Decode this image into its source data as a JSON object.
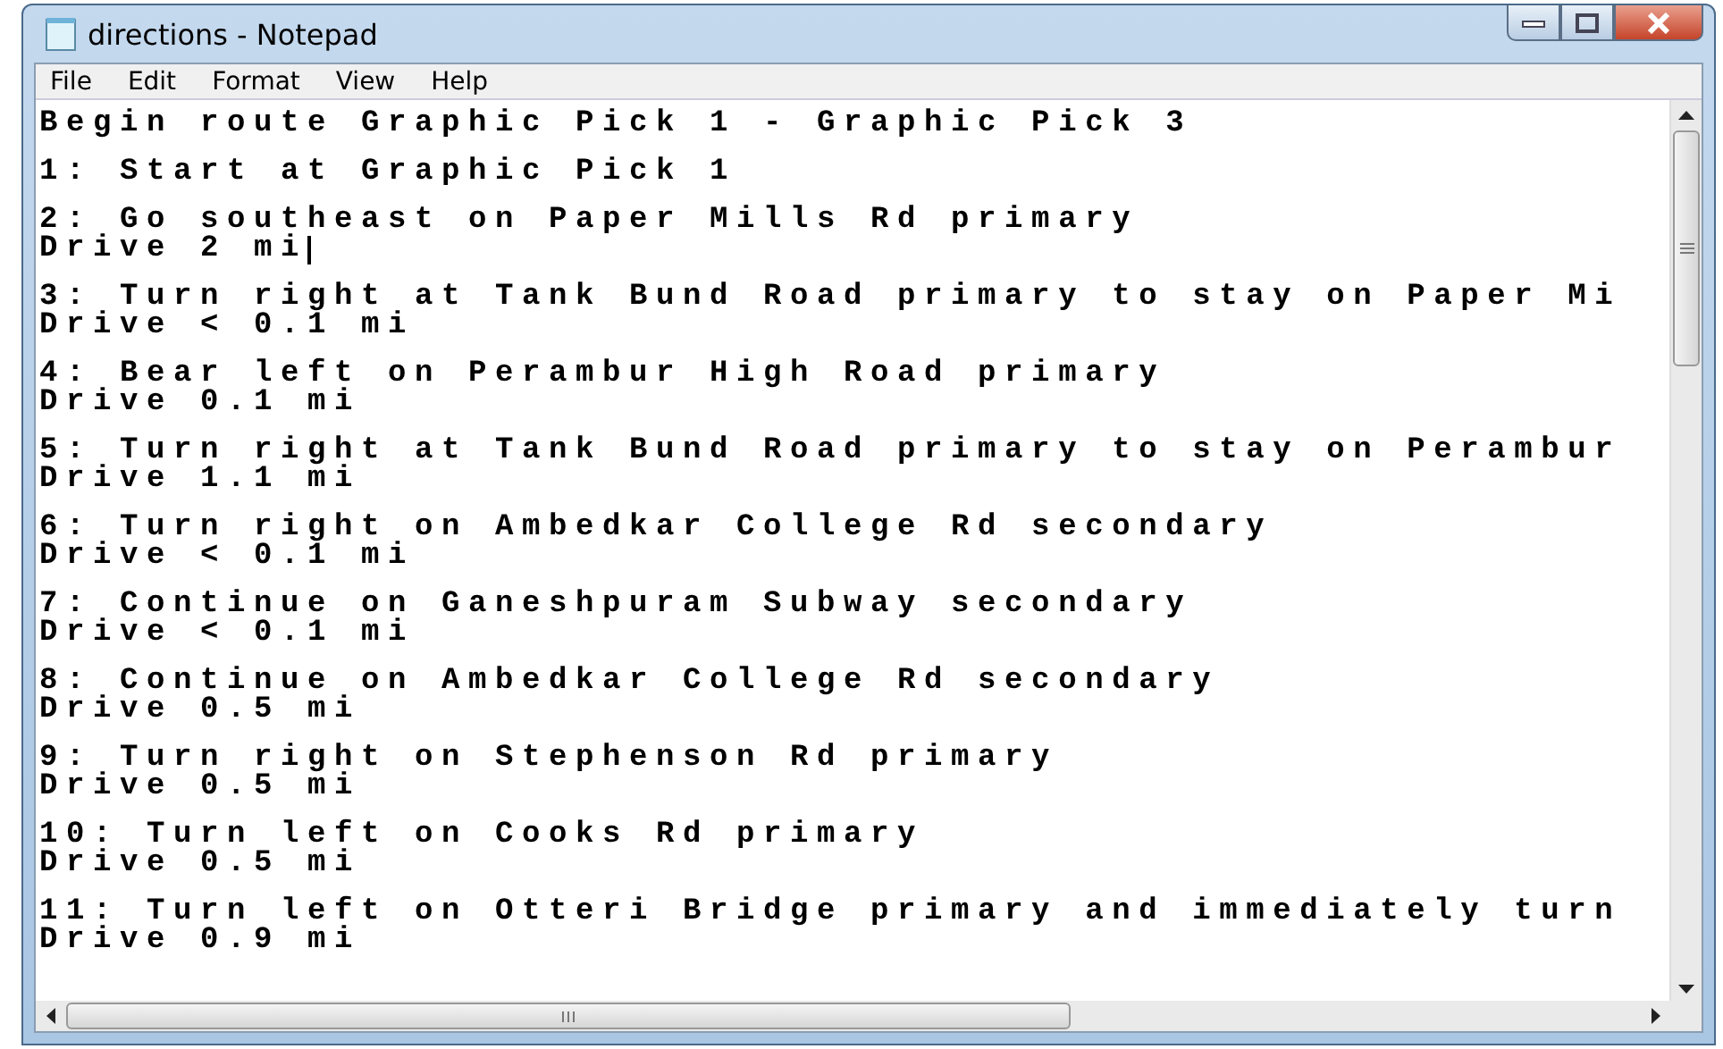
{
  "window": {
    "title": "directions - Notepad"
  },
  "menu": [
    "File",
    "Edit",
    "Format",
    "View",
    "Help"
  ],
  "document": {
    "blocks": [
      {
        "lines": [
          {
            "text": "Begin route Graphic Pick 1 - Graphic Pick 3",
            "caret": false
          }
        ]
      },
      {
        "lines": [
          {
            "text": "1: Start at Graphic Pick 1",
            "caret": false
          }
        ]
      },
      {
        "lines": [
          {
            "text": "2: Go southeast on Paper Mills Rd primary",
            "caret": false
          },
          {
            "text": "Drive 2 mi",
            "caret": true
          }
        ]
      },
      {
        "lines": [
          {
            "text": "3: Turn right at Tank Bund Road primary to stay on Paper Mi",
            "caret": false
          },
          {
            "text": "Drive < 0.1 mi",
            "caret": false
          }
        ]
      },
      {
        "lines": [
          {
            "text": "4: Bear left on Perambur High Road primary",
            "caret": false
          },
          {
            "text": "Drive 0.1 mi",
            "caret": false
          }
        ]
      },
      {
        "lines": [
          {
            "text": "5: Turn right at Tank Bund Road primary to stay on Perambur",
            "caret": false
          },
          {
            "text": "Drive 1.1 mi",
            "caret": false
          }
        ]
      },
      {
        "lines": [
          {
            "text": "6: Turn right on Ambedkar College Rd secondary",
            "caret": false
          },
          {
            "text": "Drive < 0.1 mi",
            "caret": false
          }
        ]
      },
      {
        "lines": [
          {
            "text": "7: Continue on Ganeshpuram Subway secondary",
            "caret": false
          },
          {
            "text": "Drive < 0.1 mi",
            "caret": false
          }
        ]
      },
      {
        "lines": [
          {
            "text": "8: Continue on Ambedkar College Rd secondary",
            "caret": false
          },
          {
            "text": "Drive 0.5 mi",
            "caret": false
          }
        ]
      },
      {
        "lines": [
          {
            "text": "9: Turn right on Stephenson Rd primary",
            "caret": false
          },
          {
            "text": "Drive 0.5 mi",
            "caret": false
          }
        ]
      },
      {
        "lines": [
          {
            "text": "10: Turn left on Cooks Rd primary",
            "caret": false
          },
          {
            "text": "Drive 0.5 mi",
            "caret": false
          }
        ]
      },
      {
        "lines": [
          {
            "text": "11: Turn left on Otteri Bridge primary and immediately turn",
            "caret": false
          },
          {
            "text": "Drive 0.9 mi",
            "caret": false
          }
        ]
      }
    ]
  }
}
